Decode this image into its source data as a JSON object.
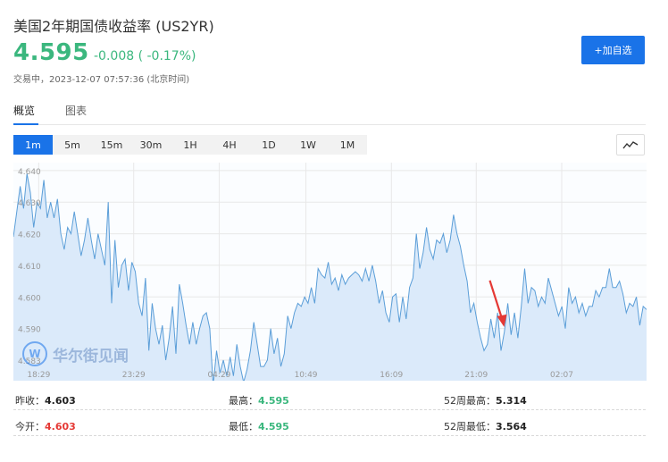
{
  "header": {
    "title": "美国2年期国债收益率 (US2YR)",
    "price": "4.595",
    "change": "-0.008 ( -0.17%)",
    "status": "交易中，2023-12-07 07:57:36 (北京时间)",
    "add_button": "+加自选"
  },
  "tabs": [
    {
      "label": "概览",
      "active": true
    },
    {
      "label": "图表",
      "active": false
    }
  ],
  "periods": [
    {
      "label": "1m",
      "active": true
    },
    {
      "label": "5m",
      "active": false
    },
    {
      "label": "15m",
      "active": false
    },
    {
      "label": "30m",
      "active": false
    },
    {
      "label": "1H",
      "active": false
    },
    {
      "label": "4H",
      "active": false
    },
    {
      "label": "1D",
      "active": false
    },
    {
      "label": "1W",
      "active": false
    },
    {
      "label": "1M",
      "active": false
    }
  ],
  "chart_type_icon": "line-chart-icon",
  "watermark": "华尔街见闻",
  "chart_data": {
    "type": "area",
    "series": [
      {
        "values": [
          4.619,
          4.627,
          4.635,
          4.628,
          4.639,
          4.633,
          4.622,
          4.63,
          4.628,
          4.637,
          4.625,
          4.63,
          4.625,
          4.631,
          4.62,
          4.615,
          4.622,
          4.62,
          4.627,
          4.62,
          4.613,
          4.618,
          4.625,
          4.618,
          4.612,
          4.62,
          4.615,
          4.61,
          4.63,
          4.598,
          4.618,
          4.603,
          4.61,
          4.612,
          4.602,
          4.611,
          4.608,
          4.598,
          4.594,
          4.606,
          4.583,
          4.598,
          4.59,
          4.585,
          4.591,
          4.58,
          4.587,
          4.597,
          4.582,
          4.604,
          4.598,
          4.591,
          4.585,
          4.592,
          4.585,
          4.59,
          4.594,
          4.595,
          4.59,
          4.572,
          4.583,
          4.576,
          4.58,
          4.575,
          4.581,
          4.575,
          4.585,
          4.578,
          4.573,
          4.577,
          4.583,
          4.592,
          4.585,
          4.578,
          4.578,
          4.58,
          4.59,
          4.582,
          4.587,
          4.578,
          4.582,
          4.594,
          4.59,
          4.595,
          4.598,
          4.597,
          4.6,
          4.598,
          4.603,
          4.598,
          4.609,
          4.607,
          4.606,
          4.611,
          4.604,
          4.606,
          4.602,
          4.607,
          4.604,
          4.606,
          4.607,
          4.608,
          4.607,
          4.605,
          4.609,
          4.605,
          4.61,
          4.605,
          4.598,
          4.602,
          4.595,
          4.592,
          4.6,
          4.601,
          4.592,
          4.6,
          4.593,
          4.603,
          4.606,
          4.62,
          4.609,
          4.614,
          4.622,
          4.615,
          4.612,
          4.618,
          4.617,
          4.62,
          4.614,
          4.618,
          4.626,
          4.62,
          4.616,
          4.61,
          4.605,
          4.595,
          4.598,
          4.592,
          4.587,
          4.583,
          4.585,
          4.593,
          4.587,
          4.595,
          4.583,
          4.589,
          4.598,
          4.588,
          4.595,
          4.587,
          4.597,
          4.609,
          4.598,
          4.603,
          4.602,
          4.597,
          4.6,
          4.598,
          4.606,
          4.602,
          4.598,
          4.594,
          4.597,
          4.59,
          4.603,
          4.598,
          4.6,
          4.595,
          4.598,
          4.594,
          4.597,
          4.597,
          4.602,
          4.6,
          4.603,
          4.603,
          4.609,
          4.603,
          4.603,
          4.605,
          4.601,
          4.595,
          4.598,
          4.597,
          4.6,
          4.591,
          4.597,
          4.596
        ]
      }
    ],
    "y_ticks": [
      "4.640",
      "4.630",
      "4.620",
      "4.610",
      "4.600",
      "4.590",
      "4.583"
    ],
    "y_tick_values": [
      4.64,
      4.63,
      4.62,
      4.61,
      4.6,
      4.59,
      4.58
    ],
    "ylim": [
      4.5735,
      4.6425
    ],
    "x_ticks": [
      {
        "label": "18:29",
        "frac": 0.04
      },
      {
        "label": "23:29",
        "frac": 0.19
      },
      {
        "label": "04:29",
        "frac": 0.325
      },
      {
        "label": "10:49",
        "frac": 0.462
      },
      {
        "label": "16:09",
        "frac": 0.597
      },
      {
        "label": "21:09",
        "frac": 0.731
      },
      {
        "label": "02:07",
        "frac": 0.866
      }
    ],
    "colors": {
      "line": "#5b9ed8",
      "fill": "#dbeafa",
      "grid": "#e8e8e8",
      "tick": "#999999",
      "arrow": "#e53935"
    },
    "annotation": "red-arrow",
    "grid": true
  },
  "stats": {
    "prev_close_label": "昨收：",
    "prev_close": "4.603",
    "high_label": "最高：",
    "high": "4.595",
    "week52_high_label": "52周最高：",
    "week52_high": "5.314",
    "open_label": "今开：",
    "open": "4.603",
    "low_label": "最低：",
    "low": "4.595",
    "week52_low_label": "52周最低：",
    "week52_low": "3.564"
  },
  "colors": {
    "accent": "#1a73e8",
    "up": "#e53935",
    "down": "#3bb77e"
  }
}
